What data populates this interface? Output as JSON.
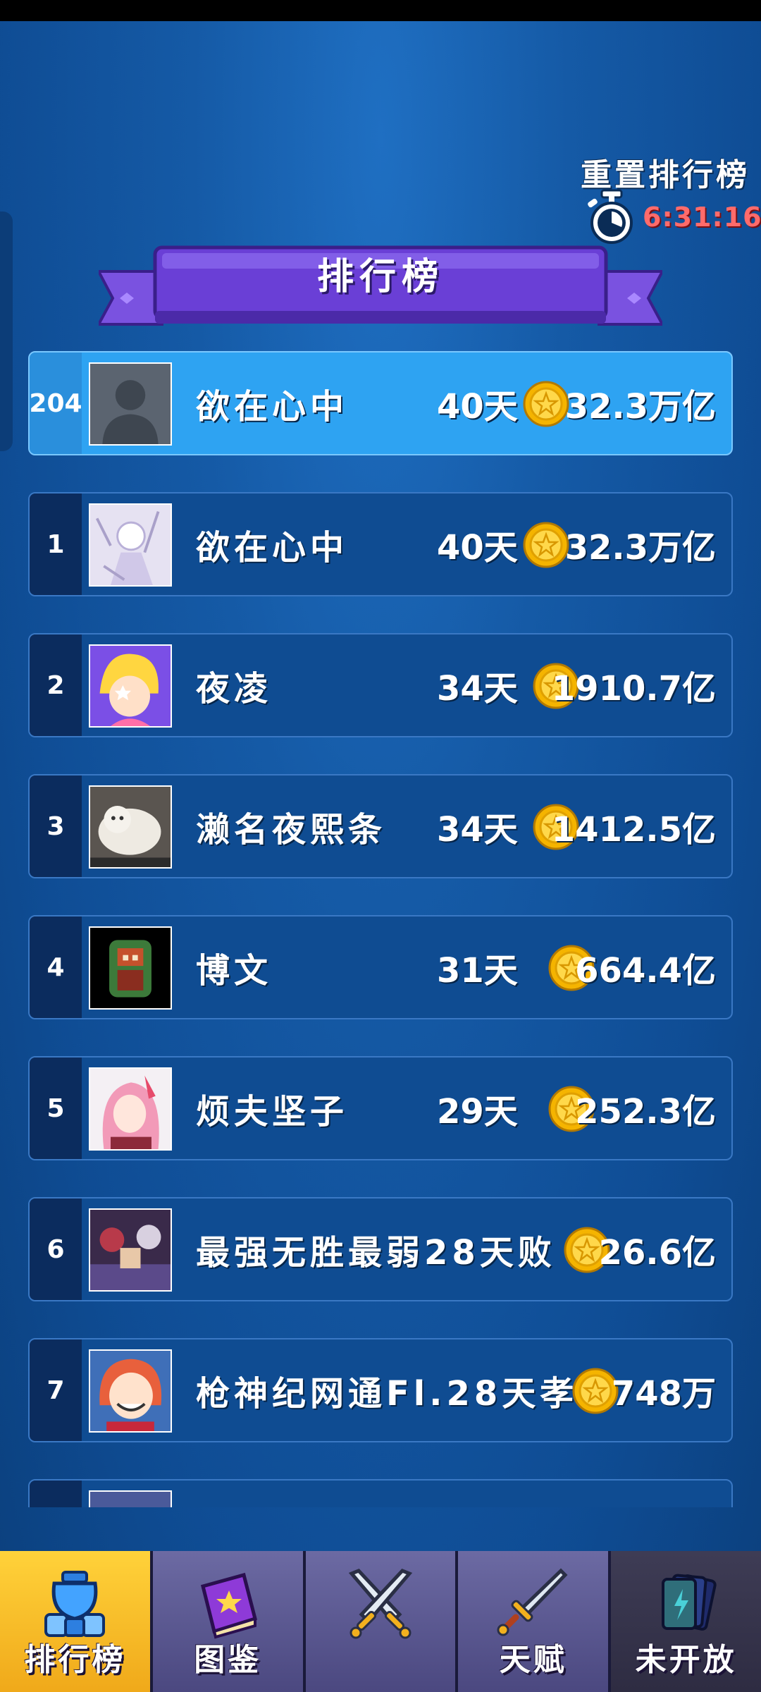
{
  "header": {
    "reset_label": "重置排行榜",
    "timer": "6:31:16",
    "title": "排行榜"
  },
  "me": {
    "rank": "204",
    "name": "欲在心中",
    "days": "40天",
    "score": "32.3万亿"
  },
  "rows": [
    {
      "rank": "1",
      "name": "欲在心中",
      "days": "40天",
      "score": "32.3万亿"
    },
    {
      "rank": "2",
      "name": "夜凌",
      "days": "34天",
      "score": "1910.7亿"
    },
    {
      "rank": "3",
      "name": "濑名夜熙条",
      "days": "34天",
      "score": "1412.5亿"
    },
    {
      "rank": "4",
      "name": "博文",
      "days": "31天",
      "score": "664.4亿"
    },
    {
      "rank": "5",
      "name": "烦夫坚子",
      "days": "29天",
      "score": "252.3亿"
    },
    {
      "rank": "6",
      "name": "最强无胜最弱28天败",
      "days": "",
      "score": "26.6亿"
    },
    {
      "rank": "7",
      "name": "枪神纪网通Fl.28天孝",
      "days": "",
      "score": "748万"
    }
  ],
  "nav": [
    {
      "label": "排行榜",
      "icon": "trophy-icon",
      "state": "active"
    },
    {
      "label": "图鉴",
      "icon": "book-icon",
      "state": "normal"
    },
    {
      "label": "",
      "icon": "crossed-swords-icon",
      "state": "normal"
    },
    {
      "label": "天赋",
      "icon": "sword-icon",
      "state": "normal"
    },
    {
      "label": "未开放",
      "icon": "cards-icon",
      "state": "disabled"
    }
  ],
  "colors": {
    "accent": "#2ea3f2",
    "timer": "#ff6b6b",
    "coin": "#ffd21a",
    "active_tab": "#ffd23a"
  }
}
